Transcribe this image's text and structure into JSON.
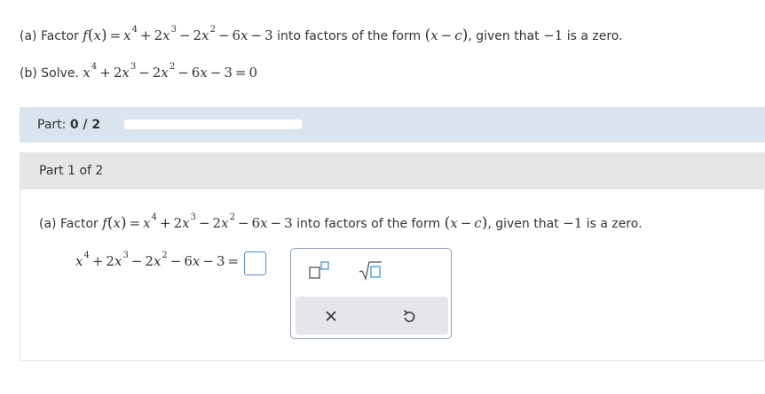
{
  "question": {
    "a_label": "(a) Factor",
    "a_tail": "into factors of the form",
    "a_given": ", given that",
    "a_zero": "−1",
    "a_end": "is a zero.",
    "b_label": "(b) Solve."
  },
  "progress": {
    "label": "Part:",
    "value": "0 / 2",
    "fraction": 0
  },
  "part": {
    "title": "Part 1 of 2",
    "prompt_label": "(a) Factor",
    "answer_value": ""
  },
  "palette": {
    "buttons": [
      "superscript-template",
      "square-root-template",
      "clear",
      "undo"
    ]
  },
  "colors": {
    "accent": "#4a8fcf",
    "part_bar": "#dae4ee",
    "part_header": "#e6e6e6",
    "palette_bottom": "#e4e6e9"
  }
}
